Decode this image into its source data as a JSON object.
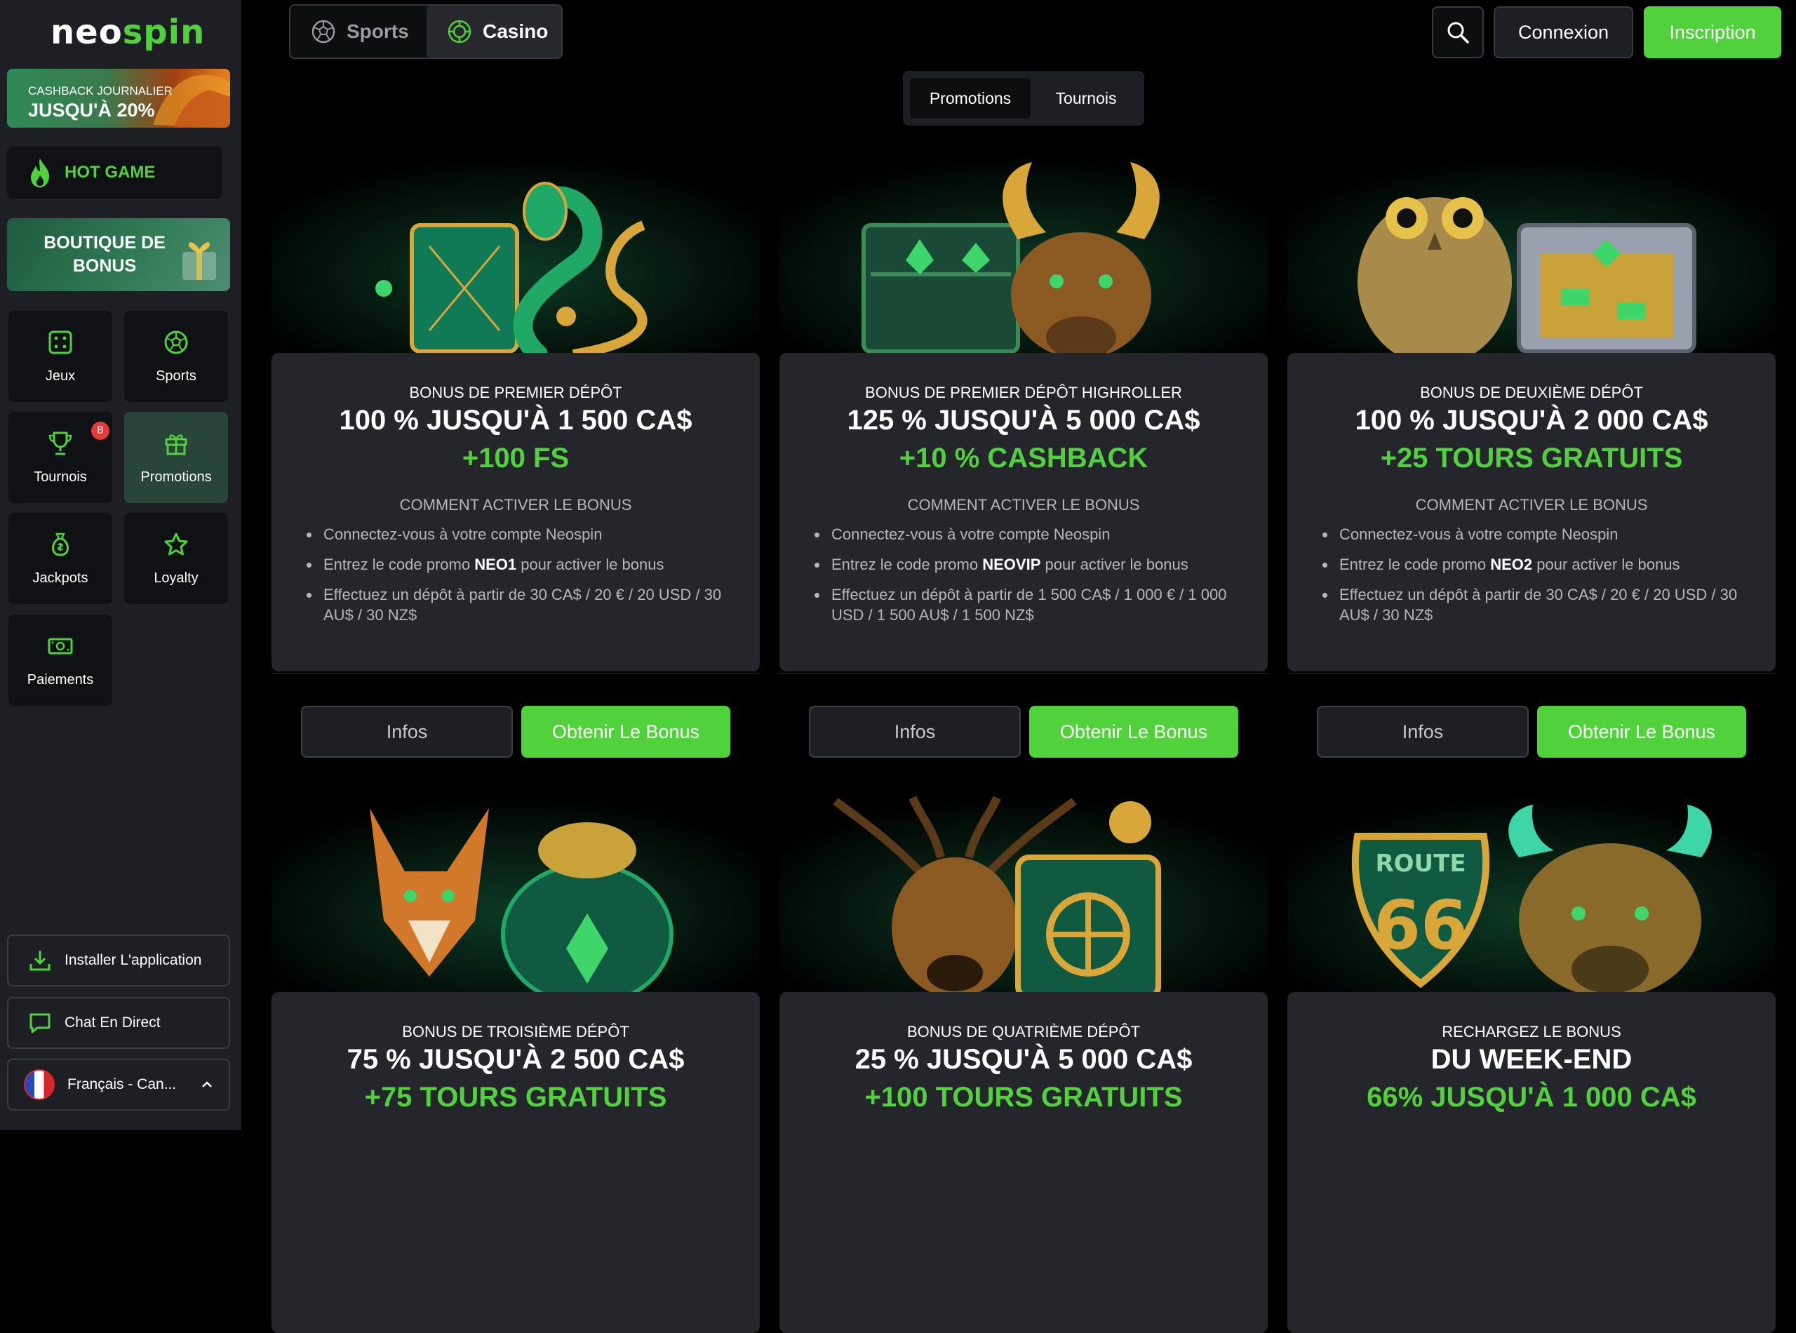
{
  "brand": {
    "logo_part1": "neo",
    "logo_part2": "spin"
  },
  "sidebar": {
    "cashback": {
      "line1": "CASHBACK JOURNALIER",
      "line2": "JUSQU'À 20%"
    },
    "hot_game": "HOT GAME",
    "boutique": "BOUTIQUE DE BONUS",
    "nav": [
      {
        "label": "Jeux",
        "icon": "dice-icon"
      },
      {
        "label": "Sports",
        "icon": "soccer-ball-icon"
      },
      {
        "label": "Tournois",
        "icon": "trophy-icon",
        "badge": "8"
      },
      {
        "label": "Promotions",
        "icon": "gift-icon"
      },
      {
        "label": "Jackpots",
        "icon": "money-bag-icon"
      },
      {
        "label": "Loyalty",
        "icon": "star-icon"
      },
      {
        "label": "Paiements",
        "icon": "cash-icon"
      }
    ],
    "install": "Installer L'application",
    "chat": "Chat En Direct",
    "language": "Français - Can..."
  },
  "topbar": {
    "sports": "Sports",
    "casino": "Casino",
    "login": "Connexion",
    "signup": "Inscription"
  },
  "tabs": {
    "promotions": "Promotions",
    "tournois": "Tournois"
  },
  "colors": {
    "accent": "#51d13b",
    "panel": "#25262b",
    "sidebar": "#1e1f24",
    "background": "#000000"
  },
  "cards": [
    {
      "caption": "BONUS DE PREMIER DÉPÔT",
      "headline": "100 % JUSQU'À 1 500 CA$",
      "highlight": "+100 FS",
      "how": "COMMENT ACTIVER LE BONUS",
      "step1": "Connectez-vous à votre compte Neospin",
      "step2_pre": "Entrez le code promo ",
      "step2_code": "NEO1",
      "step2_post": " pour activer le bonus",
      "step3": "Effectuez un dépôt à partir de 30 CA$ / 20 € / 20 USD / 30 AU$ / 30 NZ$",
      "info": "Infos",
      "get": "Obtenir Le Bonus"
    },
    {
      "caption": "BONUS DE PREMIER DÉPÔT HIGHROLLER",
      "headline": "125 % JUSQU'À 5 000 CA$",
      "highlight": "+10 % CASHBACK",
      "how": "COMMENT ACTIVER LE BONUS",
      "step1": "Connectez-vous à votre compte Neospin",
      "step2_pre": "Entrez le code promo ",
      "step2_code": "NEOVIP",
      "step2_post": " pour activer le bonus",
      "step3": "Effectuez un dépôt à partir de 1 500 CA$ / 1 000 € / 1 000 USD / 1 500 AU$ / 1 500 NZ$",
      "info": "Infos",
      "get": "Obtenir Le Bonus"
    },
    {
      "caption": "BONUS DE DEUXIÈME DÉPÔT",
      "headline": "100 % JUSQU'À 2 000 CA$",
      "highlight": "+25 TOURS GRATUITS",
      "how": "COMMENT ACTIVER LE BONUS",
      "step1": "Connectez-vous à votre compte Neospin",
      "step2_pre": "Entrez le code promo ",
      "step2_code": "NEO2",
      "step2_post": " pour activer le bonus",
      "step3": "Effectuez un dépôt à partir de 30 CA$ / 20 € / 20 USD / 30 AU$ / 30 NZ$",
      "info": "Infos",
      "get": "Obtenir Le Bonus"
    },
    {
      "caption": "BONUS DE TROISIÈME DÉPÔT",
      "headline": "75 % JUSQU'À 2 500 CA$",
      "highlight": "+75 TOURS GRATUITS"
    },
    {
      "caption": "BONUS DE QUATRIÈME DÉPÔT",
      "headline": "25 % JUSQU'À 5 000 CA$",
      "highlight": "+100 TOURS GRATUITS"
    },
    {
      "caption": "RECHARGEZ LE BONUS",
      "headline": "DU WEEK-END",
      "highlight": "66% JUSQU'À 1 000 CA$"
    }
  ]
}
